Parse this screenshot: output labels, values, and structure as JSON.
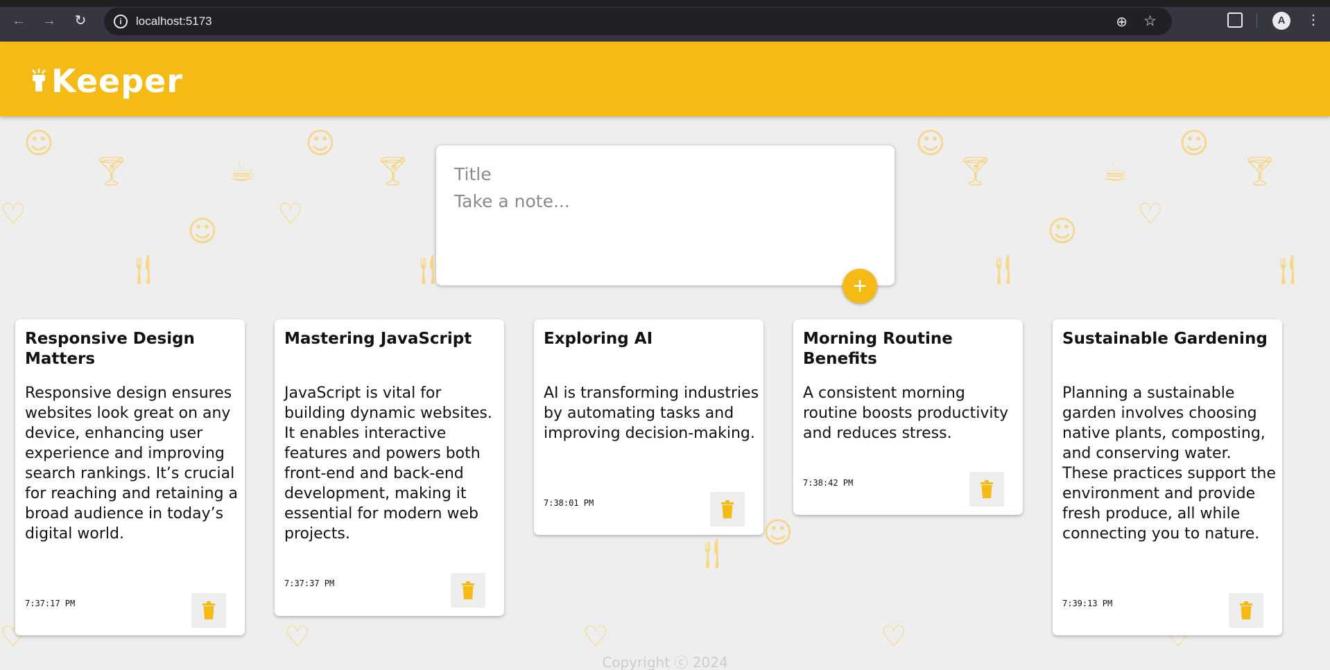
{
  "browser": {
    "url": "localhost:5173",
    "back_icon": "arrow-left-icon",
    "forward_icon": "arrow-right-icon",
    "reload_icon": "reload-icon",
    "profile_initial": "A"
  },
  "app": {
    "name": "Keeper",
    "accent": "#f5ba13"
  },
  "create_note": {
    "title_placeholder": "Title",
    "content_placeholder": "Take a note...",
    "add_label": "+"
  },
  "notes": [
    {
      "title": "Responsive Design Matters",
      "content": "Responsive design ensures websites look great on any device, enhancing user experience and improving search rankings. It’s crucial for reaching and retaining a broad audience in today’s digital world.",
      "time": "7:37:17 PM"
    },
    {
      "title": "Mastering JavaScript",
      "content": "JavaScript is vital for building dynamic websites. It enables interactive features and powers both front-end and back-end development, making it essential for modern web projects.",
      "time": "7:37:37 PM"
    },
    {
      "title": "Exploring AI",
      "content": "AI is transforming industries by automating tasks and improving decision-making.",
      "time": "7:38:01 PM"
    },
    {
      "title": "Morning Routine Benefits",
      "content": "A consistent morning routine boosts productivity and reduces stress.",
      "time": "7:38:42 PM"
    },
    {
      "title": "Sustainable Gardening",
      "content": "Planning a sustainable garden involves choosing native plants, composting, and conserving water. These practices support the environment and provide fresh produce, all while connecting you to nature.",
      "time": "7:39:13 PM"
    }
  ],
  "footer": {
    "text": "Copyright ⓒ 2024"
  }
}
